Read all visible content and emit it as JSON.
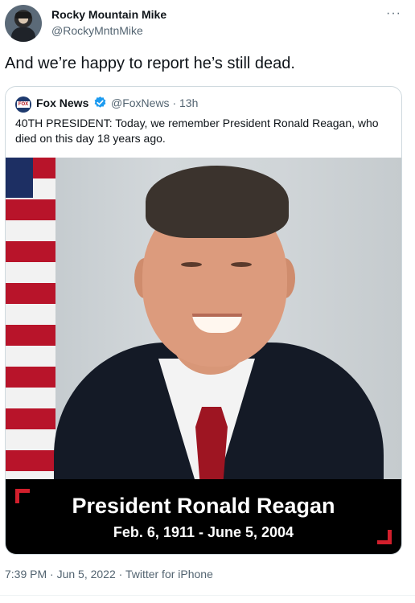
{
  "author": {
    "name": "Rocky Mountain Mike",
    "handle": "@RockyMntnMike",
    "more_icon": "more-horizontal-icon"
  },
  "tweet": {
    "text": "And we’re happy to report he’s still dead."
  },
  "quoted": {
    "name": "Fox News",
    "handle_time": "@FoxNews · 13h",
    "verified_icon": "verified-badge-icon",
    "text": "40TH PRESIDENT: Today, we remember President Ronald Reagan, who died on this day 18 years ago.",
    "image": {
      "title": "President Ronald Reagan",
      "dates": "Feb. 6, 1911 - June 5, 2004"
    }
  },
  "meta": {
    "timestamp": "7:39 PM · Jun 5, 2022 · Twitter for iPhone"
  },
  "colors": {
    "verified": "#1d9bf0",
    "banner_accent": "#d21f2c"
  }
}
